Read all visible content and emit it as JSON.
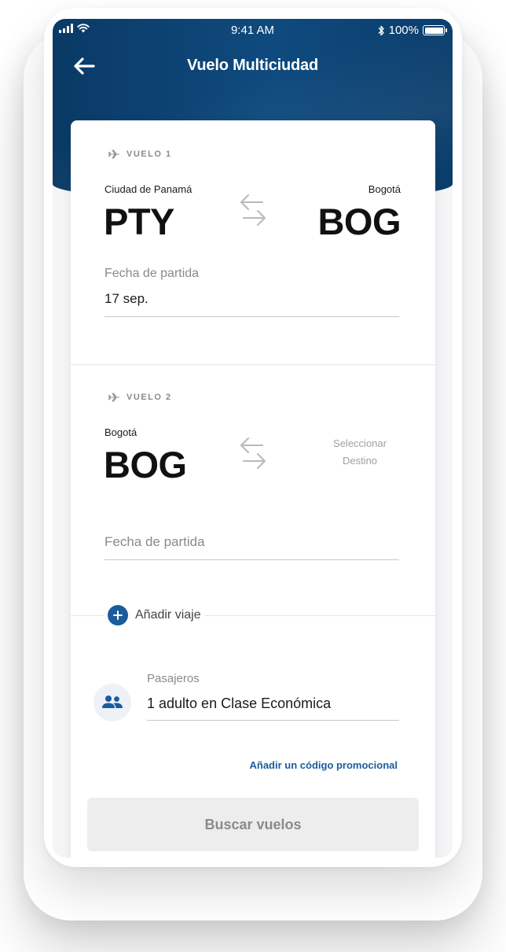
{
  "status_bar": {
    "time": "9:41 AM",
    "battery": "100%"
  },
  "nav": {
    "title": "Vuelo Multiciudad"
  },
  "flights": [
    {
      "label": "VUELO 1",
      "origin_city": "Ciudad de Panamá",
      "origin_code": "PTY",
      "destination_city": "Bogotá",
      "destination_code": "BOG",
      "date_label": "Fecha de partida",
      "date_value": "17 sep."
    },
    {
      "label": "VUELO 2",
      "origin_city": "Bogotá",
      "origin_code": "BOG",
      "destination_placeholder_line1": "Seleccionar",
      "destination_placeholder_line2": "Destino",
      "date_placeholder": "Fecha de partida"
    }
  ],
  "add_trip": {
    "label": "Añadir viaje"
  },
  "passengers": {
    "label": "Pasajeros",
    "value": "1 adulto en Clase Económica"
  },
  "promo": {
    "label": "Añadir un código promocional"
  },
  "search": {
    "label": "Buscar vuelos"
  },
  "colors": {
    "header": "#0f4a7e",
    "accent": "#1a5c9c",
    "button_disabled": "#ededee"
  }
}
